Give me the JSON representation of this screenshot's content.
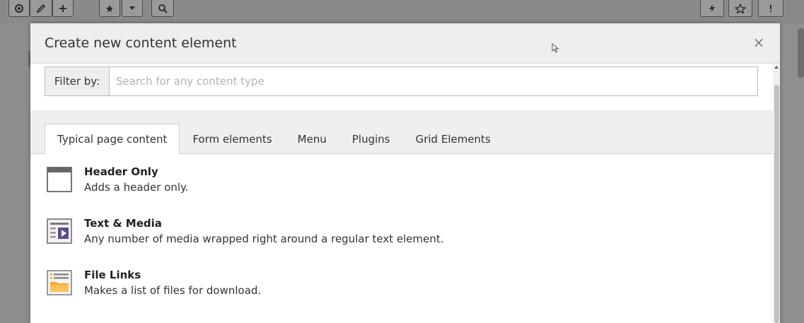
{
  "modal": {
    "title": "Create new content element",
    "close_label": "×"
  },
  "filter": {
    "label": "Filter by:",
    "placeholder": "Search for any content type",
    "value": ""
  },
  "tabs": [
    {
      "label": "Typical page content",
      "active": true
    },
    {
      "label": "Form elements",
      "active": false
    },
    {
      "label": "Menu",
      "active": false
    },
    {
      "label": "Plugins",
      "active": false
    },
    {
      "label": "Grid Elements",
      "active": false
    }
  ],
  "content_elements": [
    {
      "title": "Header Only",
      "description": "Adds a header only.",
      "icon": "header-only-icon"
    },
    {
      "title": "Text & Media",
      "description": "Any number of media wrapped right around a regular text element.",
      "icon": "text-media-icon"
    },
    {
      "title": "File Links",
      "description": "Makes a list of files for download.",
      "icon": "file-links-icon"
    }
  ],
  "background_toolbar": {
    "left_icons": [
      "view-icon",
      "edit-icon",
      "plus-icon",
      "star-icon",
      "dropdown-icon",
      "search-icon"
    ],
    "right_icons": [
      "flash-icon",
      "bookmark-icon",
      "help-icon"
    ]
  },
  "colors": {
    "accent_purple": "#5c4a8e",
    "file_orange": "#f7a824",
    "icon_grey": "#666666"
  }
}
